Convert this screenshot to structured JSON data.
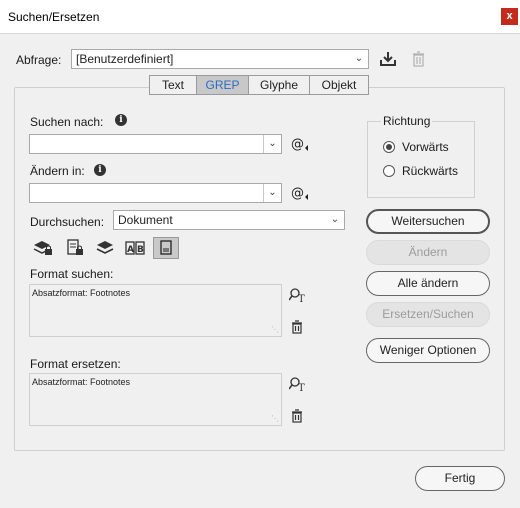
{
  "window": {
    "title": "Suchen/Ersetzen",
    "close_glyph": "x"
  },
  "query": {
    "label": "Abfrage:",
    "value": "[Benutzerdefiniert]"
  },
  "tabs": [
    {
      "label": "Text"
    },
    {
      "label": "GREP"
    },
    {
      "label": "Glyphe"
    },
    {
      "label": "Objekt"
    }
  ],
  "active_tab": "GREP",
  "search": {
    "label": "Suchen nach:",
    "value": ""
  },
  "replace": {
    "label": "Ändern in:",
    "value": ""
  },
  "scope": {
    "label": "Durchsuchen:",
    "value": "Dokument"
  },
  "direction": {
    "label": "Richtung",
    "options": [
      {
        "label": "Vorwärts"
      },
      {
        "label": "Rückwärts"
      }
    ],
    "selected": "Vorwärts"
  },
  "format_search": {
    "label": "Format suchen:",
    "value": "Absatzformat: Footnotes"
  },
  "format_replace": {
    "label": "Format ersetzen:",
    "value": "Absatzformat: Footnotes"
  },
  "buttons": {
    "find_next": "Weitersuchen",
    "change": "Ändern",
    "change_all": "Alle ändern",
    "change_find": "Ersetzen/Suchen",
    "fewer_options": "Weniger Optionen",
    "done": "Fertig"
  },
  "colors": {
    "active_tab_text": "#2b6cc4",
    "active_tab_bg": "#c8c8c8",
    "close_button": "#c42b1c",
    "dialog_bg": "#f0f0f0"
  }
}
